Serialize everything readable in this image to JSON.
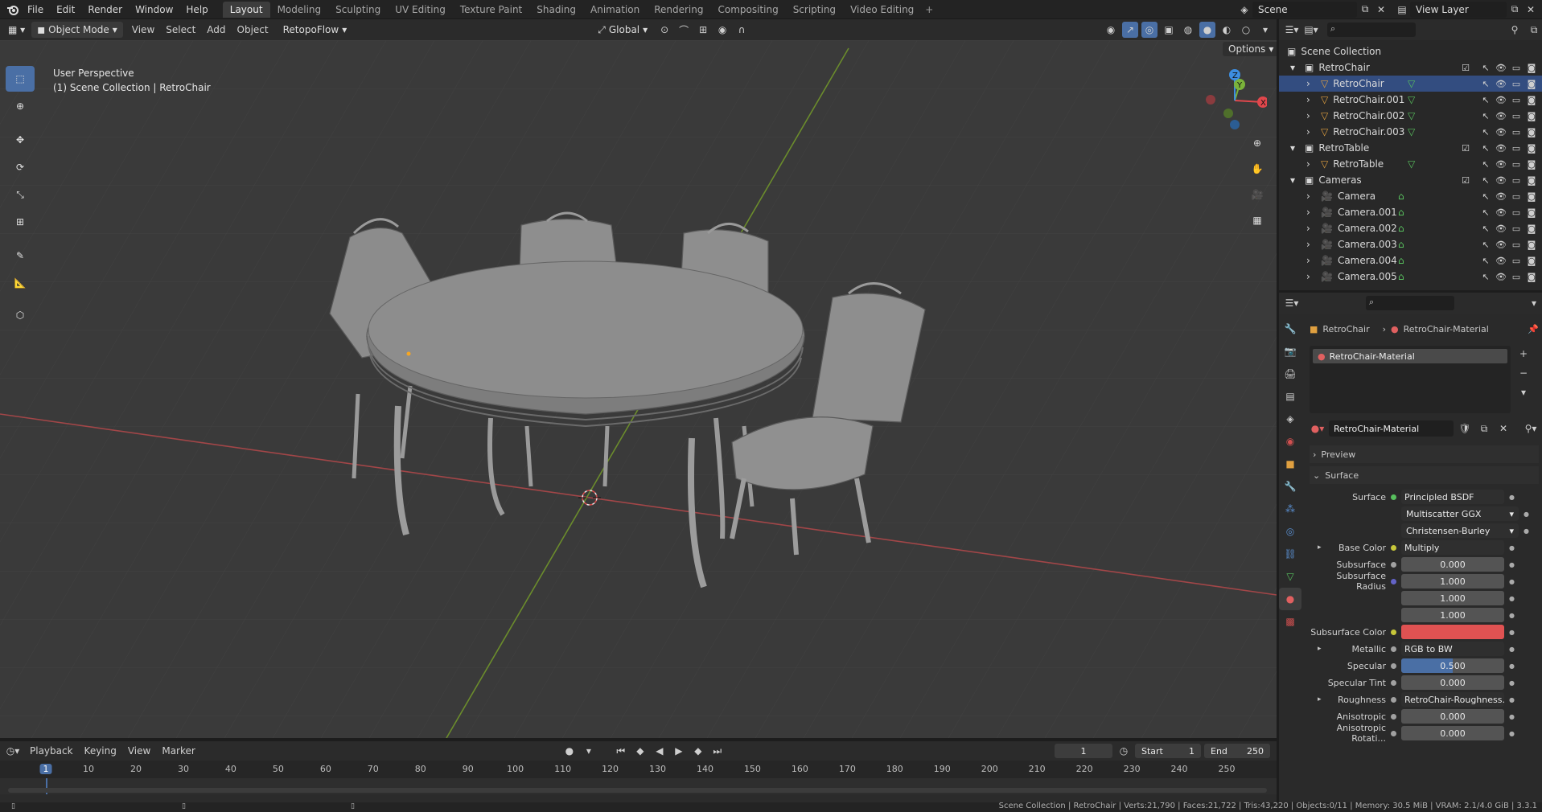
{
  "menus": [
    "File",
    "Edit",
    "Render",
    "Window",
    "Help"
  ],
  "workspaces": [
    "Layout",
    "Modeling",
    "Sculpting",
    "UV Editing",
    "Texture Paint",
    "Shading",
    "Animation",
    "Rendering",
    "Compositing",
    "Scripting",
    "Video Editing"
  ],
  "scene_name": "Scene",
  "view_layer": "View Layer",
  "viewport_header": {
    "mode": "Object Mode",
    "menus": [
      "View",
      "Select",
      "Add",
      "Object"
    ],
    "addon": "RetopoFlow",
    "transform_orientation": "Global",
    "options_label": "Options"
  },
  "viewport": {
    "view_name": "User Perspective",
    "collection_path": "(1) Scene Collection | RetroChair"
  },
  "outliner": {
    "scene_collection": "Scene Collection",
    "collections": [
      {
        "name": "RetroChair",
        "objects": [
          "RetroChair",
          "RetroChair.001",
          "RetroChair.002",
          "RetroChair.003"
        ]
      },
      {
        "name": "RetroTable",
        "objects": [
          "RetroTable"
        ]
      },
      {
        "name": "Cameras",
        "objects": [
          "Camera",
          "Camera.001",
          "Camera.002",
          "Camera.003",
          "Camera.004",
          "Camera.005"
        ]
      }
    ]
  },
  "properties": {
    "breadcrumb_object": "RetroChair",
    "breadcrumb_material": "RetroChair-Material",
    "material_slot": "RetroChair-Material",
    "material_name": "RetroChair-Material",
    "preview_label": "Preview",
    "surface_label": "Surface",
    "fields": [
      {
        "label": "Surface",
        "value": "Principled BSDF",
        "kind": "link",
        "dot": "#58c05e"
      },
      {
        "label": "",
        "value": "Multiscatter GGX",
        "kind": "dropdown"
      },
      {
        "label": "",
        "value": "Christensen-Burley",
        "kind": "dropdown"
      },
      {
        "label": "Base Color",
        "value": "Multiply",
        "kind": "link",
        "dot": "#c7c73a",
        "expand": true
      },
      {
        "label": "Subsurface",
        "value": "0.000",
        "kind": "number",
        "dot": "#a1a1a1"
      },
      {
        "label": "Subsurface Radius",
        "value": "1.000",
        "kind": "number",
        "dot": "#6363c7"
      },
      {
        "label": "",
        "value": "1.000",
        "kind": "number"
      },
      {
        "label": "",
        "value": "1.000",
        "kind": "number"
      },
      {
        "label": "Subsurface Color",
        "value": "",
        "kind": "color",
        "dot": "#c7c73a",
        "color": "#e05252"
      },
      {
        "label": "Metallic",
        "value": "RGB to BW",
        "kind": "link",
        "dot": "#a1a1a1",
        "expand": true
      },
      {
        "label": "Specular",
        "value": "0.500",
        "kind": "slider",
        "dot": "#a1a1a1",
        "fill": 0.5
      },
      {
        "label": "Specular Tint",
        "value": "0.000",
        "kind": "number",
        "dot": "#a1a1a1"
      },
      {
        "label": "Roughness",
        "value": "RetroChair-Roughness.p...",
        "kind": "link",
        "dot": "#a1a1a1",
        "expand": true
      },
      {
        "label": "Anisotropic",
        "value": "0.000",
        "kind": "number",
        "dot": "#a1a1a1"
      },
      {
        "label": "Anisotropic Rotati...",
        "value": "0.000",
        "kind": "number",
        "dot": "#a1a1a1"
      }
    ]
  },
  "timeline": {
    "menus": [
      "Playback",
      "Keying",
      "View",
      "Marker"
    ],
    "current_frame": "1",
    "start_label": "Start",
    "start": "1",
    "end_label": "End",
    "end": "250",
    "ruler": [
      "1",
      "10",
      "20",
      "30",
      "40",
      "50",
      "60",
      "70",
      "80",
      "90",
      "100",
      "110",
      "120",
      "130",
      "140",
      "150",
      "160",
      "170",
      "180",
      "190",
      "200",
      "210",
      "220",
      "230",
      "240",
      "250"
    ]
  },
  "statusbar": "Scene Collection | RetroChair | Verts:21,790 | Faces:21,722 | Tris:43,220 | Objects:0/11 | Memory: 30.5 MiB | VRAM: 2.1/4.0 GiB | 3.3.1",
  "colors": {
    "accent": "#4a6fa5",
    "x_axis": "#e0474c",
    "y_axis": "#7ab33a",
    "z_axis": "#3d8ee0",
    "selected_dot": "#f5a623"
  }
}
